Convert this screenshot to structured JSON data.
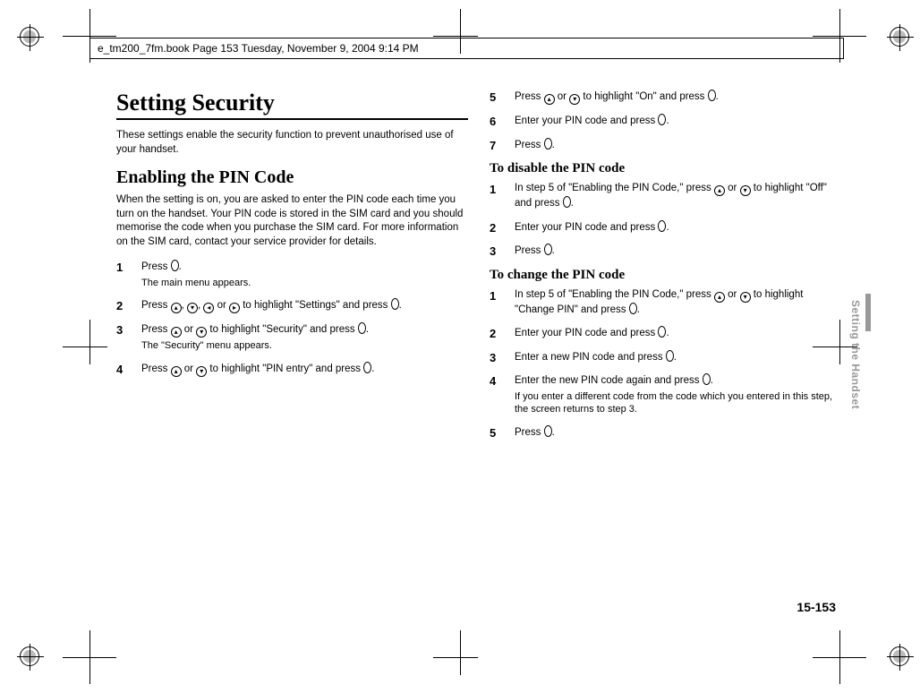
{
  "header": {
    "text": "e_tm200_7fm.book  Page 153  Tuesday, November 9, 2004  9:14 PM"
  },
  "left": {
    "h1": "Setting Security",
    "intro": "These settings enable the security function to prevent unauthorised use of your handset.",
    "h2": "Enabling the PIN Code",
    "h2_intro": "When the setting is on, you are asked to enter the PIN code each time you turn on the handset. Your PIN code is stored in the SIM card and you should memorise the code when you purchase the SIM card. For more information on the SIM card, contact your service provider for details.",
    "steps": {
      "s1_a": "Press ",
      "s1_b": ".",
      "s1_sub": "The main menu appears.",
      "s2_a": "Press ",
      "s2_b": ", ",
      "s2_c": ", ",
      "s2_d": " or ",
      "s2_e": " to highlight \"Settings\" and press ",
      "s2_f": ".",
      "s3_a": "Press ",
      "s3_b": " or ",
      "s3_c": " to highlight \"Security\" and press ",
      "s3_d": ".",
      "s3_sub": "The \"Security\" menu appears.",
      "s4_a": "Press ",
      "s4_b": " or ",
      "s4_c": " to highlight \"PIN entry\" and press ",
      "s4_d": "."
    }
  },
  "right": {
    "s5_a": "Press ",
    "s5_b": " or ",
    "s5_c": " to highlight \"On\" and press ",
    "s5_d": ".",
    "s6_a": "Enter your PIN code and press ",
    "s6_b": ".",
    "s7_a": "Press ",
    "s7_b": ".",
    "h3a": "To disable the PIN code",
    "d1_a": "In step 5 of \"Enabling the PIN Code,\" press ",
    "d1_b": " or ",
    "d1_c": " to highlight \"Off\" and press ",
    "d1_d": ".",
    "d2_a": "Enter your PIN code and press ",
    "d2_b": ".",
    "d3_a": "Press ",
    "d3_b": ".",
    "h3b": "To change the PIN code",
    "c1_a": "In step 5 of \"Enabling the PIN Code,\" press ",
    "c1_b": " or ",
    "c1_c": " to highlight \"Change PIN\" and press ",
    "c1_d": ".",
    "c2_a": "Enter your PIN code and press ",
    "c2_b": ".",
    "c3_a": "Enter a new PIN code and press ",
    "c3_b": ".",
    "c4_a": "Enter the new PIN code again and press ",
    "c4_b": ".",
    "c4_sub": "If you enter a different code from the code which you entered in this step, the screen returns to step 3.",
    "c5_a": "Press ",
    "c5_b": "."
  },
  "side_tab": "Setting the Handset",
  "page_number": "15-153"
}
